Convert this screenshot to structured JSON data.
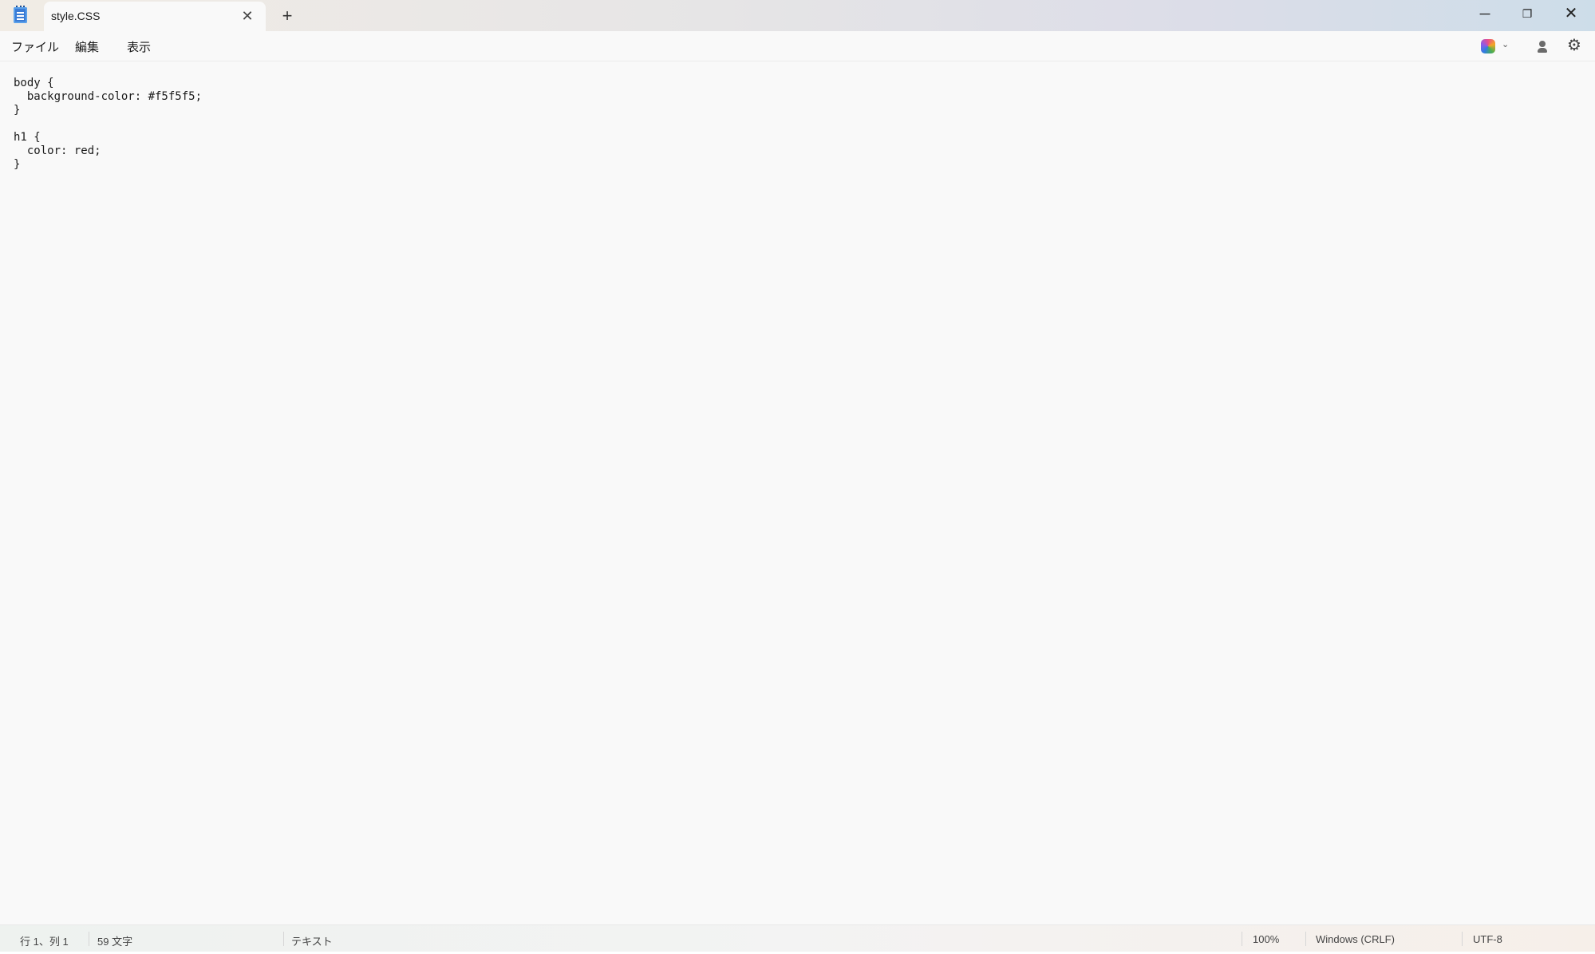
{
  "titlebar": {
    "tab_title": "style.CSS",
    "close_tab_glyph": "✕",
    "new_tab_glyph": "+",
    "minimize_glyph": "─",
    "maximize_glyph": "❐",
    "close_window_glyph": "✕",
    "app_icon": "notepad-icon"
  },
  "menu": {
    "file": "ファイル",
    "edit": "編集",
    "view": "表示",
    "copilot_icon": "copilot-icon",
    "copilot_caret": "⌄",
    "account_icon": "account-icon",
    "settings_glyph": "⚙"
  },
  "editor": {
    "content": "body {\n  background-color: #f5f5f5;\n}\n\nh1 {\n  color: red;\n}"
  },
  "status": {
    "position": "行 1、列 1",
    "char_count": "59 文字",
    "mode": "テキスト",
    "zoom": "100%",
    "line_ending": "Windows (CRLF)",
    "encoding": "UTF-8"
  }
}
